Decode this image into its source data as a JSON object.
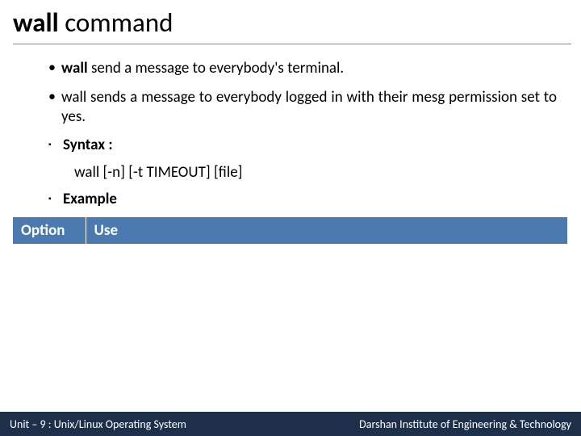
{
  "title": {
    "bold": "wall",
    "rest": " command"
  },
  "bullets": {
    "b1": {
      "bold": "wall",
      "rest": " send a message to everybody's terminal."
    },
    "b2": "wall sends a message to everybody logged in with their mesg permission set to yes.",
    "syntax_label": "Syntax :",
    "syntax_code": "wall [-n] [-t TIMEOUT] [file]",
    "example_label": "Example"
  },
  "table": {
    "h1": "Option",
    "h2": "Use"
  },
  "footer": {
    "left": "Unit – 9  : Unix/Linux Operating System",
    "right": "Darshan Institute of Engineering & Technology"
  }
}
